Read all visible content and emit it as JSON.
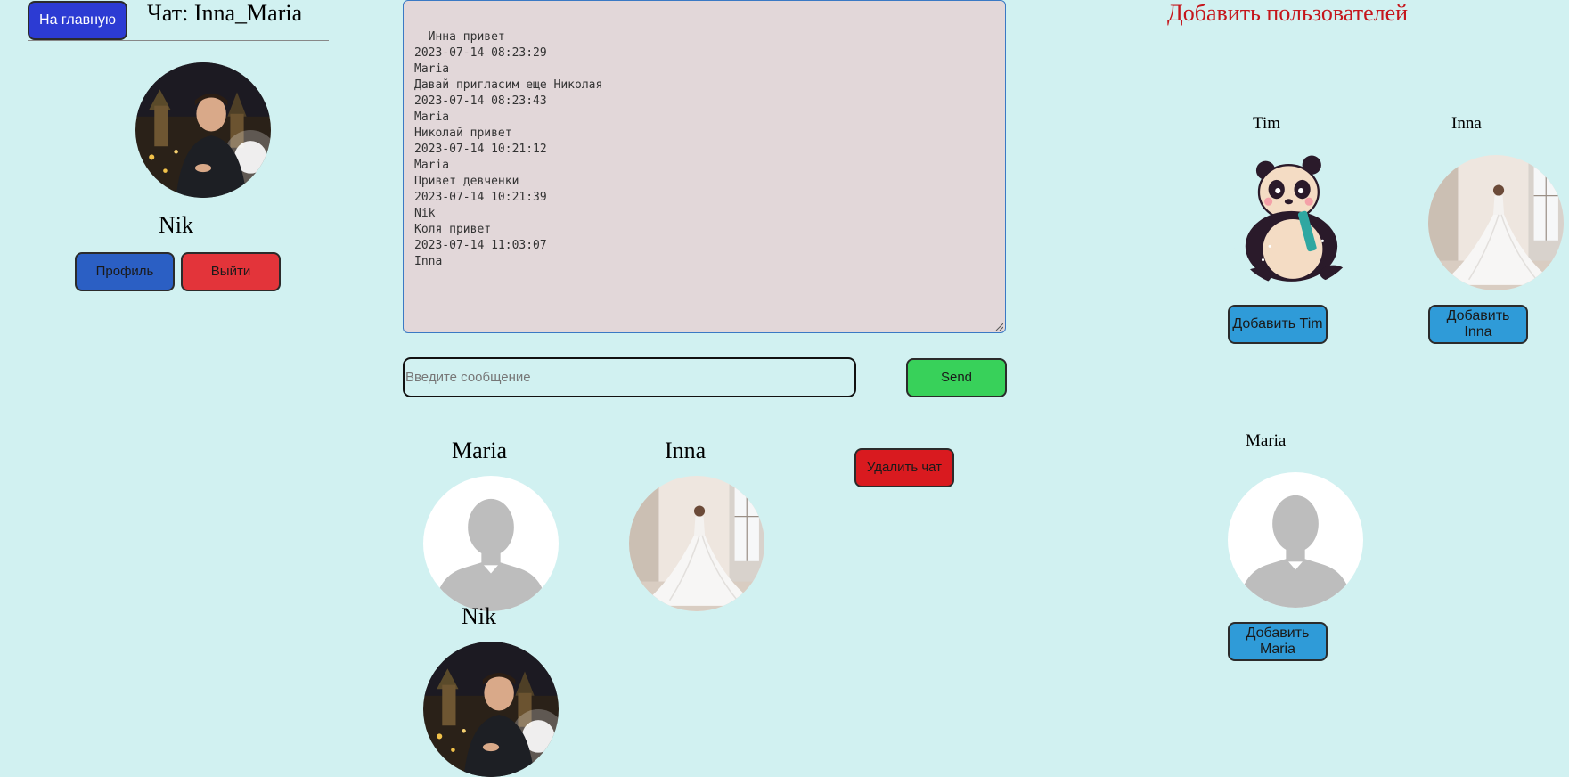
{
  "header": {
    "home_button": "На главную",
    "chat_title": "Чат: Inna_Maria"
  },
  "current_user": {
    "name": "Nik",
    "profile_button": "Профиль",
    "logout_button": "Выйти"
  },
  "chat": {
    "log": "Инна привет\n2023-07-14 08:23:29\nMaria\nДавай пригласим еще Николая\n2023-07-14 08:23:43\nMaria\nНиколай привет\n2023-07-14 10:21:12\nMaria\nПривет девченки\n2023-07-14 10:21:39\nNik\nКоля привет\n2023-07-14 11:03:07\nInna",
    "input_placeholder": "Введите сообщение",
    "input_value": "",
    "send_button": "Send",
    "delete_button": "Удалить чат"
  },
  "members": [
    {
      "name": "Maria",
      "avatar": "default-person-avatar"
    },
    {
      "name": "Inna",
      "avatar": "bride-photo-avatar"
    },
    {
      "name": "Nik",
      "avatar": "nik-photo-avatar"
    }
  ],
  "add_users": {
    "title": "Добавить пользователей",
    "users": [
      {
        "name": "Tim",
        "avatar": "panda-avatar",
        "button": "Добавить Tim"
      },
      {
        "name": "Inna",
        "avatar": "bride-photo-avatar",
        "button": "Добавить Inna"
      },
      {
        "name": "Maria",
        "avatar": "default-person-avatar",
        "button": "Добавить Maria"
      }
    ]
  },
  "colors": {
    "background": "#d1f1f1",
    "home_button": "#2c3bd3",
    "profile_button": "#2b5fc4",
    "logout_button": "#e3343a",
    "send_button": "#38d15a",
    "delete_button": "#d91a1f",
    "add_button": "#2f9bd8",
    "add_title": "#c5161c",
    "chat_log_bg": "#e2d7d9"
  }
}
